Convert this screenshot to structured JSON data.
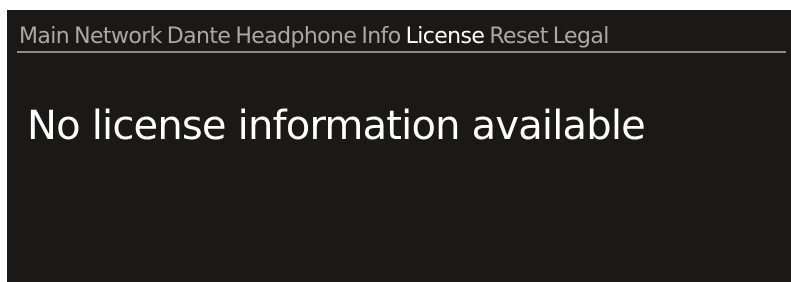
{
  "tabs": [
    {
      "label": "Main",
      "active": false
    },
    {
      "label": "Network",
      "active": false
    },
    {
      "label": "Dante",
      "active": false
    },
    {
      "label": "Headphone",
      "active": false
    },
    {
      "label": "Info",
      "active": false
    },
    {
      "label": "License",
      "active": true
    },
    {
      "label": "Reset",
      "active": false
    },
    {
      "label": "Legal",
      "active": false
    }
  ],
  "main": {
    "message": "No license information available"
  },
  "colors": {
    "background": "#1b1917",
    "active_tab": "#ffffff",
    "inactive_tab": "#a8a8a8",
    "divider": "#8c8c8c"
  }
}
